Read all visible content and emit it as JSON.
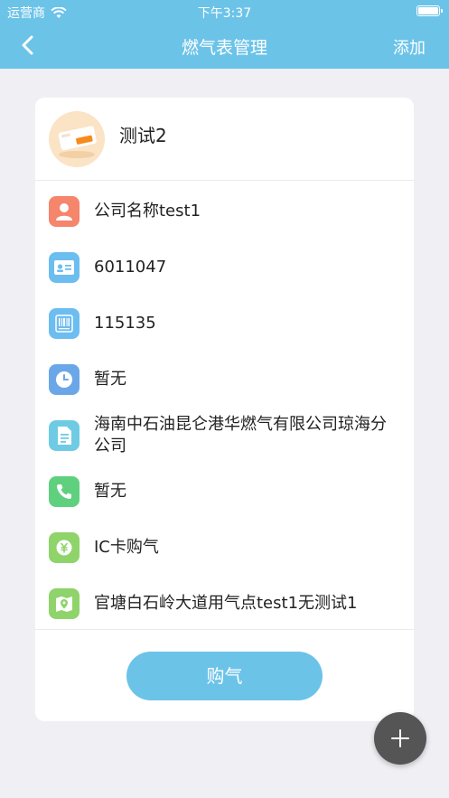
{
  "status_bar": {
    "carrier": "运营商",
    "time": "下午3:37"
  },
  "nav": {
    "title": "燃气表管理",
    "add_label": "添加"
  },
  "meter": {
    "name": "测试2"
  },
  "details": [
    {
      "icon": "user-icon",
      "text": "公司名称test1",
      "color": "#f5856b"
    },
    {
      "icon": "id-card-icon",
      "text": "6011047",
      "color": "#6cbdf0"
    },
    {
      "icon": "barcode-icon",
      "text": "115135",
      "color": "#6cbdf0"
    },
    {
      "icon": "clock-icon",
      "text": "暂无",
      "color": "#6ba7e8"
    },
    {
      "icon": "document-icon",
      "text": "海南中石油昆仑港华燃气有限公司琼海分公司",
      "color": "#6fcbe3"
    },
    {
      "icon": "phone-icon",
      "text": "暂无",
      "color": "#5fd07e"
    },
    {
      "icon": "yuan-coin-icon",
      "text": "IC卡购气",
      "color": "#8ed46a"
    },
    {
      "icon": "map-pin-icon",
      "text": "官塘白石岭大道用气点test1无测试1",
      "color": "#8ed46a"
    }
  ],
  "buy_button_label": "购气",
  "colors": {
    "header": "#6cc3e8",
    "background": "#efeff4",
    "fab": "#555555"
  }
}
